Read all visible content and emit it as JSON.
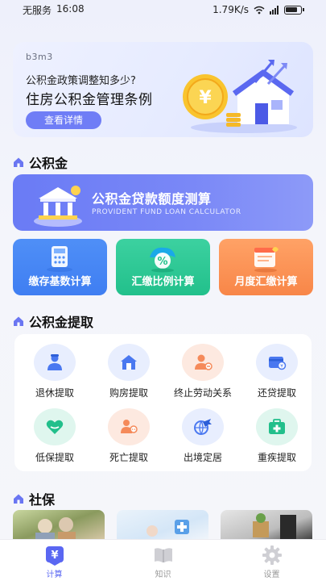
{
  "status": {
    "carrier": "无服务",
    "time": "16:08",
    "speed": "1.79K/s"
  },
  "banner": {
    "tag": "b3m3",
    "subtitle": "公积金政策调整知多少?",
    "title": "住房公积金管理条例",
    "button": "查看详情"
  },
  "sections": {
    "fund": "公积金",
    "withdraw": "公积金提取",
    "social": "社保"
  },
  "loan_card": {
    "title": "公积金贷款额度测算",
    "subtitle": "PROVIDENT FUND LOAN CALCULATOR"
  },
  "calc_cards": [
    {
      "label": "缴存基数计算",
      "icon": "calculator-icon"
    },
    {
      "label": "汇缴比例计算",
      "icon": "percent-icon"
    },
    {
      "label": "月度汇缴计算",
      "icon": "calendar-icon"
    }
  ],
  "withdraw_items": [
    {
      "label": "退休提取",
      "icon": "retire-icon",
      "color": "#4a78f0"
    },
    {
      "label": "购房提取",
      "icon": "house-icon",
      "color": "#4a78f0"
    },
    {
      "label": "终止劳动关系",
      "icon": "person-end-icon",
      "color": "#f58a5a"
    },
    {
      "label": "还贷提取",
      "icon": "wallet-icon",
      "color": "#4a78f0"
    },
    {
      "label": "低保提取",
      "icon": "heart-icon",
      "color": "#22bf8b"
    },
    {
      "label": "死亡提取",
      "icon": "people-icon",
      "color": "#f58a5a"
    },
    {
      "label": "出境定居",
      "icon": "plane-icon",
      "color": "#4a78f0"
    },
    {
      "label": "重疾提取",
      "icon": "medical-kit-icon",
      "color": "#22bf8b"
    }
  ],
  "tabs": [
    {
      "label": "计算",
      "active": true
    },
    {
      "label": "知识",
      "active": false
    },
    {
      "label": "设置",
      "active": false
    }
  ]
}
